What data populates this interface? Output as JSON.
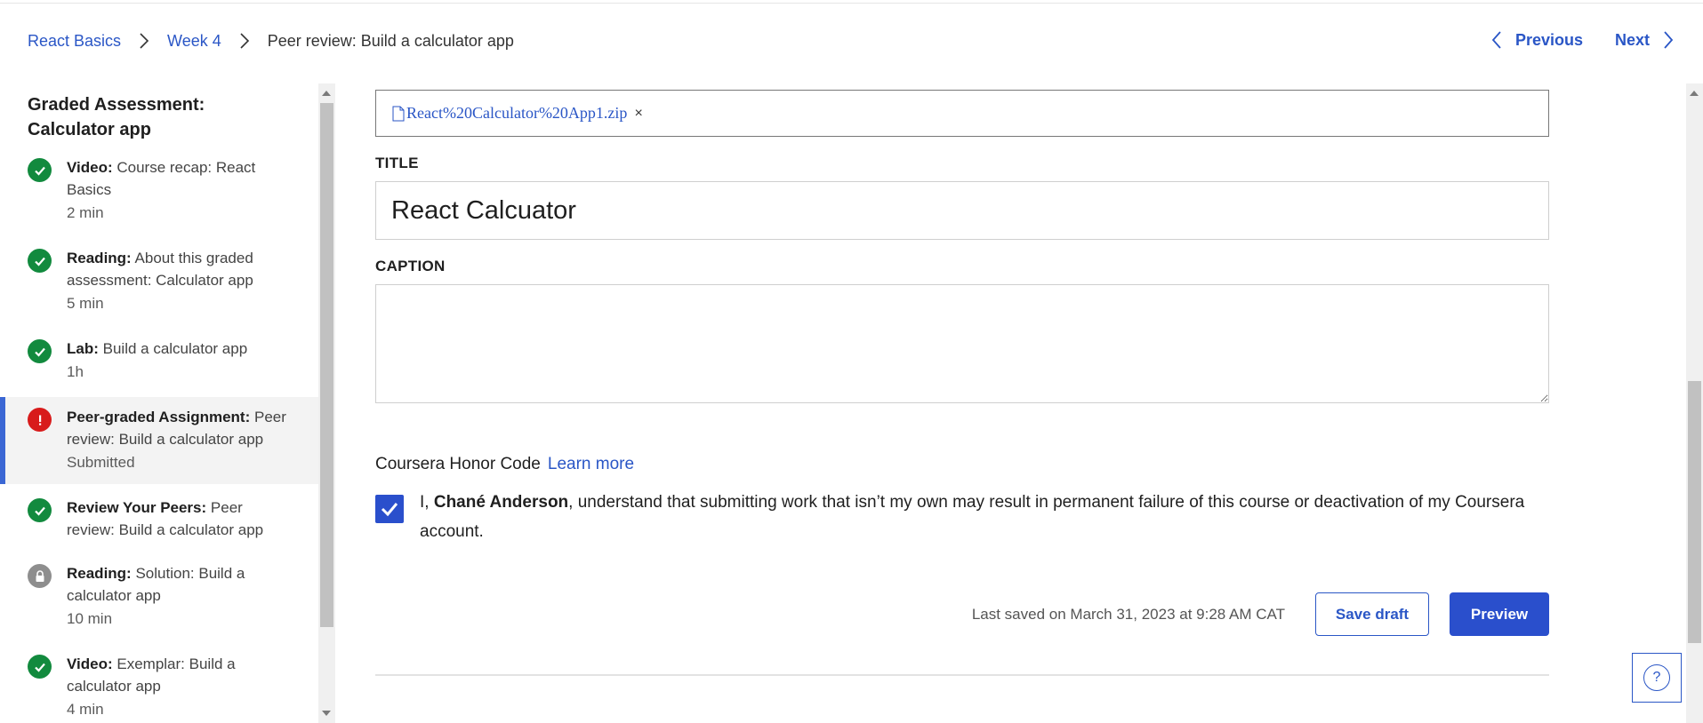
{
  "breadcrumb": {
    "course": "React Basics",
    "week": "Week 4",
    "current": "Peer review: Build a calculator app"
  },
  "pager": {
    "previous": "Previous",
    "next": "Next"
  },
  "sidebar": {
    "title": "Graded Assessment: Calculator app",
    "items": [
      {
        "type": "Video:",
        "title": "Course recap: React Basics",
        "meta": "2 min",
        "status": "done"
      },
      {
        "type": "Reading:",
        "title": "About this graded assessment: Calculator app",
        "meta": "5 min",
        "status": "done"
      },
      {
        "type": "Lab:",
        "title": "Build a calculator app",
        "meta": "1h",
        "status": "done"
      },
      {
        "type": "Peer-graded Assignment:",
        "title": "Peer review: Build a calculator app",
        "meta": "Submitted",
        "status": "error"
      },
      {
        "type": "Review Your Peers:",
        "title": "Peer review: Build a calculator app",
        "meta": "",
        "status": "done"
      },
      {
        "type": "Reading:",
        "title": "Solution: Build a calculator app",
        "meta": "10 min",
        "status": "locked"
      },
      {
        "type": "Video:",
        "title": "Exemplar: Build a calculator app",
        "meta": "4 min",
        "status": "done"
      }
    ]
  },
  "form": {
    "file_name": "React%20Calculator%20App1.zip",
    "file_remove": "×",
    "title_label": "TITLE",
    "title_value": "React Calcuator",
    "caption_label": "CAPTION",
    "caption_value": "",
    "honor_label": "Coursera Honor Code",
    "learn_more": "Learn more",
    "agree_prefix": "I, ",
    "agree_name": "Chané Anderson",
    "agree_rest": ", understand that submitting work that isn’t my own may result in permanent failure of this course or deactivation of my Coursera account.",
    "agree_checked": true,
    "last_saved": "Last saved on March 31, 2023 at 9:28 AM CAT",
    "save_draft": "Save draft",
    "preview": "Preview"
  },
  "help": {
    "label": "?"
  },
  "colors": {
    "link": "#2a56c6",
    "primary": "#2a4fcc",
    "done": "#128a3e",
    "error": "#d81b1b",
    "locked": "#8e8e8e",
    "active_border": "#3b67d4"
  },
  "icons": {
    "done": "check-circle-icon",
    "error": "alert-circle-icon",
    "locked": "lock-circle-icon"
  }
}
